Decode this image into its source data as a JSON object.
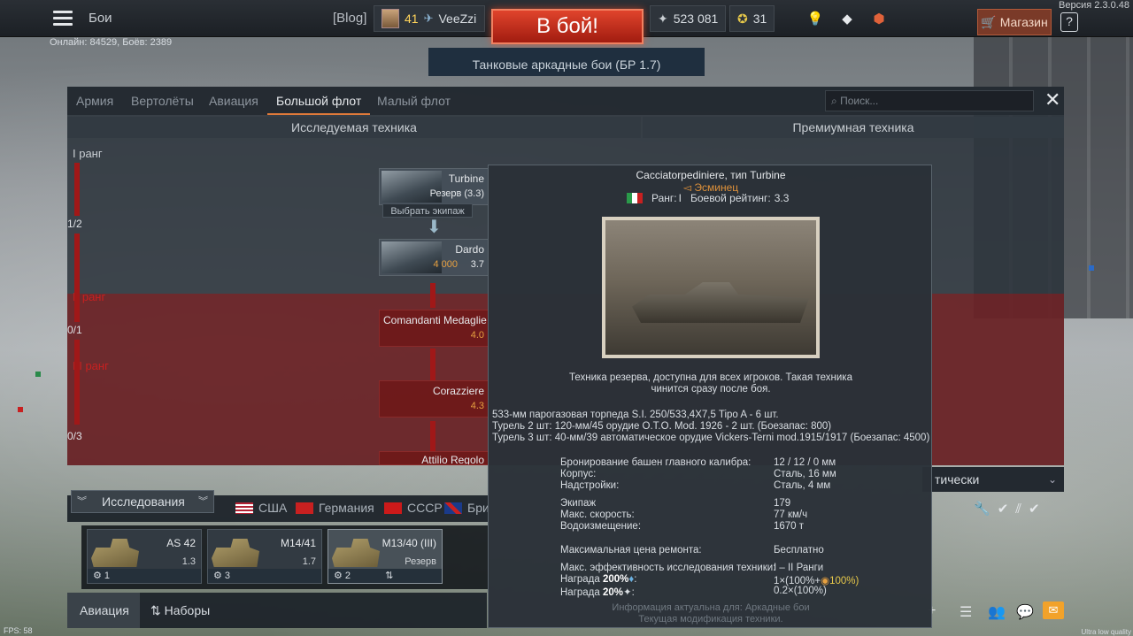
{
  "top": {
    "title": "Бои",
    "blog": "[Blog]",
    "level": "41",
    "nickname": "VeeZzi",
    "battle_button": "В бой!",
    "mode": "Танковые аркадные бои (БР 1.7)",
    "silver": "523 081",
    "gold": "31",
    "shop": "Магазин",
    "help": "?",
    "version": "Версия 2.3.0.48",
    "online": "Онлайн: 84529, Боёв: 2389"
  },
  "research": {
    "tabs": [
      "Армия",
      "Вертолёты",
      "Авиация",
      "Большой флот",
      "Малый флот"
    ],
    "active_tab": "Большой флот",
    "search_placeholder": "Поиск...",
    "section_researched": "Исследуемая техника",
    "section_premium": "Премиумная техника",
    "rank1": "I ранг",
    "rank2": "II ранг",
    "rank3": "III ранг",
    "frac1": "1/2",
    "frac2": "0/1",
    "frac3": "0/3",
    "choose_crew": "Выбрать экипаж",
    "vehicles": [
      {
        "name": "Turbine",
        "sub": "Резерв (3.3)"
      },
      {
        "name": "Dardo",
        "cost": "4 000",
        "br": "3.7"
      },
      {
        "name": "Comandanti Medaglie",
        "br": "4.0"
      },
      {
        "name": "Corazziere",
        "br": "4.3"
      },
      {
        "name": "Attilio Regolo",
        "br": ""
      }
    ],
    "filter_dropdown": "тически"
  },
  "popup": {
    "title": "Cacciatorpediniere, тип Turbine",
    "class": "Эсминец",
    "rank_label": "Ранг:",
    "rank_value": "I",
    "br_label": "Боевой рейтинг:",
    "br_value": "3.3",
    "desc_line1": "Техника резерва, доступна для всех игроков. Такая техника",
    "desc_line2": "чинится сразу после боя.",
    "armament": [
      "533-мм парогазовая торпеда S.I. 250/533,4X7,5 Tipo A - 6 шт.",
      "Турель 2 шт: 120-мм/45 орудие O.T.O. Mod. 1926 - 2 шт. (Боезапас: 800)",
      "Турель 3 шт: 40-мм/39 автоматическое орудие Vickers-Terni mod.1915/1917 (Боезапас: 4500)"
    ],
    "stats": [
      {
        "label": "Бронирование башен главного калибра:",
        "value": "12 / 12 / 0 мм"
      },
      {
        "label": "Корпус:",
        "value": "Сталь, 16 мм"
      },
      {
        "label": "Надстройки:",
        "value": "Сталь, 4 мм"
      },
      {
        "label": "Экипаж",
        "value": "179"
      },
      {
        "label": "Макс. скорость:",
        "value": "77 км/ч"
      },
      {
        "label": "Водоизмещение:",
        "value": "1670 т"
      },
      {
        "label": "Максимальная цена ремонта:",
        "value": "Бесплатно"
      },
      {
        "label": "Макс. эффективность исследования техники:",
        "value": "I – II Ранги"
      }
    ],
    "reward1_label": "Награда",
    "reward1_pct": "200%",
    "reward1_value": "1×(100%+",
    "reward1_bonus": "100%)",
    "reward2_label": "Награда",
    "reward2_pct": "20%",
    "reward2_value": "0.2×(100%)",
    "footer1": "Информация актуальна для: Аркадные бои",
    "footer2": "Текущая модификация техники."
  },
  "bottom": {
    "research_tab": "Исследования",
    "nations": [
      "США",
      "Германия",
      "СССР",
      "Бри"
    ],
    "slots": [
      {
        "name": "AS 42",
        "br": "1.3",
        "crew": "1"
      },
      {
        "name": "M14/41",
        "br": "1.7",
        "crew": "3"
      },
      {
        "name": "M13/40 (III)",
        "br": "Резерв",
        "crew": "2"
      }
    ],
    "aviation": "Авиация",
    "presets": "Наборы",
    "fps": "FPS: 58",
    "quality": "Ultra low quality"
  },
  "colors": {
    "battle_red": "#c52e1c",
    "rank_red": "#a01818",
    "accent_orange": "#e07a3a",
    "gold": "#e6c84a"
  }
}
